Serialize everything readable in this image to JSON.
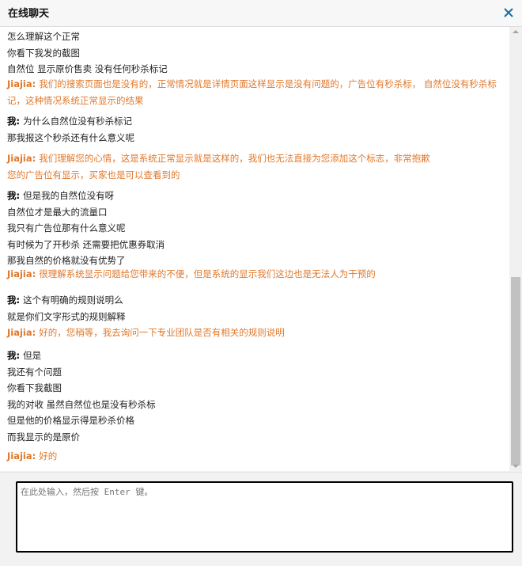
{
  "window": {
    "title": "在线聊天"
  },
  "icons": {
    "close": "close-icon",
    "scroll_up": "arrow-up-icon",
    "scroll_down": "arrow-down-icon"
  },
  "colors": {
    "agent_text": "#e0782b",
    "user_text": "#222222"
  },
  "messages": [
    {
      "speaker": "",
      "role": "user",
      "lines": [
        "怎么理解这个正常",
        "你看下我发的截图",
        "自然位 显示原价售卖 没有任何秒杀标记"
      ]
    },
    {
      "speaker": "Jiajia:",
      "role": "agent",
      "lines": [
        "我们的搜索页面也是没有的，正常情况就是详情页面这样显示是没有问题的，广告位有秒杀标，  自然位没有秒杀标记，这种情况系统正常显示的结果"
      ]
    },
    {
      "speaker": "我:",
      "role": "user",
      "lines": [
        "为什么自然位没有秒杀标记",
        "那我报这个秒杀还有什么意义呢"
      ]
    },
    {
      "speaker": "Jiajia:",
      "role": "agent",
      "lines": [
        "我们理解您的心情，这是系统正常显示就是这样的，我们也无法直接为您添加这个标志，非常抱歉",
        "您的广告位有显示，买家也是可以查看到的"
      ]
    },
    {
      "speaker": "我:",
      "role": "user",
      "lines": [
        "但是我的自然位没有呀",
        "自然位才是最大的流量口",
        "我只有广告位那有什么意义呢",
        "有时候为了开秒杀 还需要把优惠券取消",
        "那我自然的价格就没有优势了"
      ]
    },
    {
      "speaker": "Jiajia:",
      "role": "agent",
      "lines": [
        "很理解系统显示问题给您带来的不便，但是系统的显示我们这边也是无法人为干预的"
      ]
    },
    {
      "speaker": "我:",
      "role": "user",
      "lines": [
        "这个有明确的规则说明么",
        "就是你们文字形式的规则解释"
      ]
    },
    {
      "speaker": "Jiajia:",
      "role": "agent",
      "lines": [
        "好的，您稍等，我去询问一下专业团队是否有相关的规则说明"
      ]
    },
    {
      "speaker": "我:",
      "role": "user",
      "lines": [
        "但是",
        "我还有个问题",
        "你看下我截图",
        "我的对收 虽然自然位也是没有秒杀标",
        "但是他的价格显示得是秒杀价格",
        "而我显示的是原价"
      ]
    },
    {
      "speaker": "Jiajia:",
      "role": "agent",
      "lines": [
        "好的"
      ]
    }
  ],
  "input": {
    "placeholder": "在此处输入，然后按 Enter 键。",
    "value": ""
  }
}
